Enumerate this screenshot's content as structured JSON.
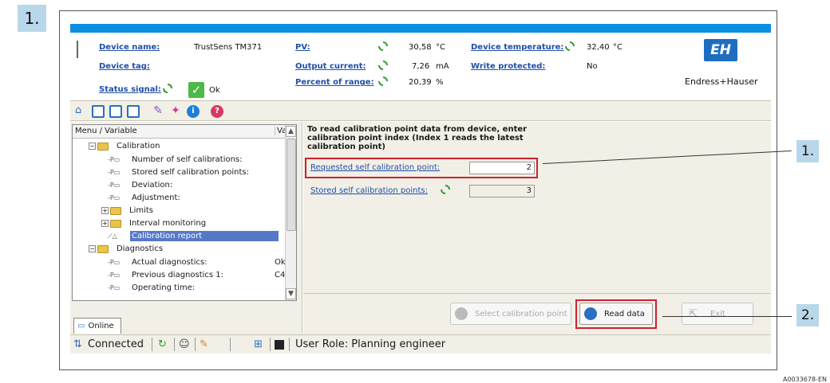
{
  "annotations": {
    "step_top": "1.",
    "callout_1": "1.",
    "callout_2": "2.",
    "figure_id": "A0033678-EN"
  },
  "header": {
    "device_name_label": "Device name:",
    "device_name_value": "TrustSens TM371",
    "device_tag_label": "Device tag:",
    "status_signal_label": "Status signal:",
    "status_signal_value": "Ok",
    "pv_label": "PV:",
    "pv_value": "30,58",
    "pv_unit": "°C",
    "output_current_label": "Output current:",
    "output_current_value": "7,26",
    "output_current_unit": "mA",
    "percent_of_range_label": "Percent of range:",
    "percent_of_range_value": "20,39",
    "percent_of_range_unit": "%",
    "device_temperature_label": "Device temperature:",
    "device_temperature_value": "32,40",
    "device_temperature_unit": "°C",
    "write_protected_label": "Write protected:",
    "write_protected_value": "No",
    "logo_text": "EH",
    "brand": "Endress+Hauser"
  },
  "toolbar": {
    "icons": [
      "home-icon",
      "view-1-icon",
      "view-2-icon",
      "view-3-icon",
      "tools-icon",
      "sparkle-icon",
      "info-icon",
      "help-icon"
    ]
  },
  "tree": {
    "col_menu": "Menu / Variable",
    "col_value": "Va",
    "rows": [
      {
        "label": "Calibration",
        "kind": "folder",
        "expanded": true,
        "level": 1
      },
      {
        "label": "Number of self calibrations:",
        "kind": "param",
        "level": 2,
        "value": ""
      },
      {
        "label": "Stored self calibration points:",
        "kind": "param",
        "level": 2,
        "value": ""
      },
      {
        "label": "Deviation:",
        "kind": "param",
        "level": 2,
        "value": ""
      },
      {
        "label": "Adjustment:",
        "kind": "param",
        "level": 2,
        "value": ""
      },
      {
        "label": "Limits",
        "kind": "folder",
        "expanded": false,
        "level": 2
      },
      {
        "label": "Interval monitoring",
        "kind": "folder",
        "expanded": false,
        "level": 2
      },
      {
        "label": "Calibration report",
        "kind": "wizard",
        "level": 2,
        "selected": true
      },
      {
        "label": "Diagnostics",
        "kind": "folder",
        "expanded": true,
        "level": 1
      },
      {
        "label": "Actual diagnostics:",
        "kind": "param",
        "level": 2,
        "value": "Ok"
      },
      {
        "label": "Previous diagnostics 1:",
        "kind": "param",
        "level": 2,
        "value": "C4"
      },
      {
        "label": "Operating time:",
        "kind": "param",
        "level": 2,
        "value": ""
      }
    ],
    "online_tab": "Online"
  },
  "form": {
    "instruction": "To read calibration point data from device, enter calibration point index (Index 1 reads the latest calibration point)",
    "requested_label": "Requested self calibration point:",
    "requested_value": "2",
    "stored_label": "Stored self calibration points:",
    "stored_value": "3"
  },
  "buttons": {
    "select_calibration_point": "Select calibration point",
    "read_data": "Read data",
    "exit": "Exit"
  },
  "status_bar": {
    "connection": "Connected",
    "user_role": "User Role: Planning engineer"
  },
  "colors": {
    "accent_blue": "#0a8fe0",
    "link_blue": "#1f4fa8",
    "highlight_red": "#d0202e",
    "selection": "#5679c7",
    "panel_bg": "#f2efe6"
  }
}
